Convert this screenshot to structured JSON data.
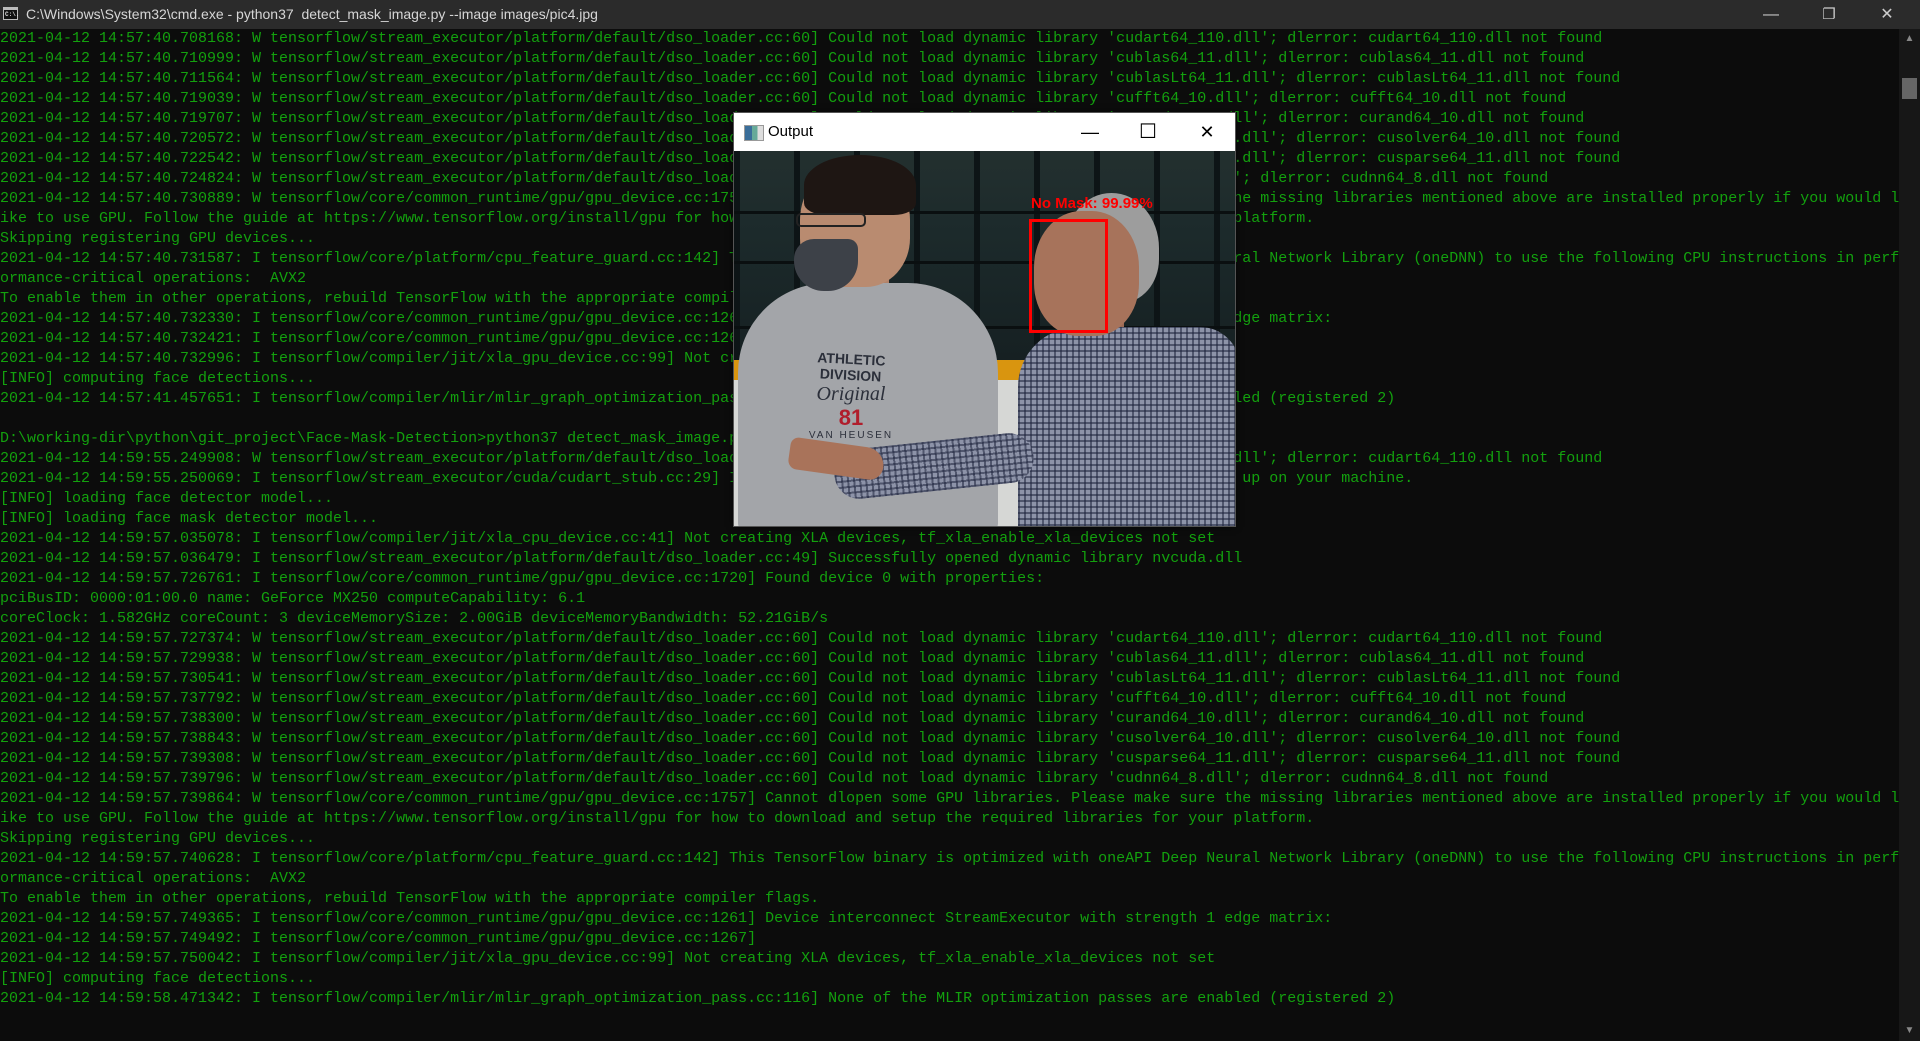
{
  "window": {
    "title": "C:\\Windows\\System32\\cmd.exe - python37  detect_mask_image.py --image images/pic4.jpg",
    "icon": "cmd-icon",
    "icon_text": "C:\\.",
    "minimize": "—",
    "restore": "❐",
    "close": "✕"
  },
  "colors": {
    "text": "#13a10e",
    "background": "#0c0c0c",
    "detection": "#ff0000"
  },
  "scrollbar": {
    "up": "▲",
    "down": "▼"
  },
  "terminal": {
    "lines": [
      "2021-04-12 14:57:40.708168: W tensorflow/stream_executor/platform/default/dso_loader.cc:60] Could not load dynamic library 'cudart64_110.dll'; dlerror: cudart64_110.dll not found",
      "2021-04-12 14:57:40.710999: W tensorflow/stream_executor/platform/default/dso_loader.cc:60] Could not load dynamic library 'cublas64_11.dll'; dlerror: cublas64_11.dll not found",
      "2021-04-12 14:57:40.711564: W tensorflow/stream_executor/platform/default/dso_loader.cc:60] Could not load dynamic library 'cublasLt64_11.dll'; dlerror: cublasLt64_11.dll not found",
      "2021-04-12 14:57:40.719039: W tensorflow/stream_executor/platform/default/dso_loader.cc:60] Could not load dynamic library 'cufft64_10.dll'; dlerror: cufft64_10.dll not found",
      "2021-04-12 14:57:40.719707: W tensorflow/stream_executor/platform/default/dso_loader.cc:60] Could not load dynamic library 'curand64_10.dll'; dlerror: curand64_10.dll not found",
      "2021-04-12 14:57:40.720572: W tensorflow/stream_executor/platform/default/dso_loader.cc:60] Could not load dynamic library 'cusolver64_10.dll'; dlerror: cusolver64_10.dll not found",
      "2021-04-12 14:57:40.722542: W tensorflow/stream_executor/platform/default/dso_loader.cc:60] Could not load dynamic library 'cusparse64_11.dll'; dlerror: cusparse64_11.dll not found",
      "2021-04-12 14:57:40.724824: W tensorflow/stream_executor/platform/default/dso_loader.cc:60] Could not load dynamic library 'cudnn64_8.dll'; dlerror: cudnn64_8.dll not found",
      "2021-04-12 14:57:40.730889: W tensorflow/core/common_runtime/gpu/gpu_device.cc:1757] Cannot dlopen some GPU libraries. Please make sure the missing libraries mentioned above are installed properly if you would l",
      "ike to use GPU. Follow the guide at https://www.tensorflow.org/install/gpu for how to download and setup the required libraries for your platform.",
      "Skipping registering GPU devices...",
      "2021-04-12 14:57:40.731587: I tensorflow/core/platform/cpu_feature_guard.cc:142] This TensorFlow binary is optimized with oneAPI Deep Neural Network Library (oneDNN) to use the following CPU instructions in perf",
      "ormance-critical operations:  AVX2",
      "To enable them in other operations, rebuild TensorFlow with the appropriate compiler flags.",
      "2021-04-12 14:57:40.732330: I tensorflow/core/common_runtime/gpu/gpu_device.cc:1261] Device interconnect StreamExecutor with strength 1 edge matrix:",
      "2021-04-12 14:57:40.732421: I tensorflow/core/common_runtime/gpu/gpu_device.cc:1267]",
      "2021-04-12 14:57:40.732996: I tensorflow/compiler/jit/xla_gpu_device.cc:99] Not creating XLA devices, tf_xla_enable_xla_devices not set",
      "[INFO] computing face detections...",
      "2021-04-12 14:57:41.457651: I tensorflow/compiler/mlir/mlir_graph_optimization_pass.cc:116] None of the MLIR optimization passes are enabled (registered 2)",
      "",
      "D:\\working-dir\\python\\git_project\\Face-Mask-Detection>python37 detect_mask_image.py --image images/pic4.jpg",
      "2021-04-12 14:59:55.249908: W tensorflow/stream_executor/platform/default/dso_loader.cc:60] Could not load dynamic library 'cudart64_110.dll'; dlerror: cudart64_110.dll not found",
      "2021-04-12 14:59:55.250069: I tensorflow/stream_executor/cuda/cudart_stub.cc:29] Ignore above cudart dlerror if you do not have a GPU set up on your machine.",
      "[INFO] loading face detector model...",
      "[INFO] loading face mask detector model...",
      "2021-04-12 14:59:57.035078: I tensorflow/compiler/jit/xla_cpu_device.cc:41] Not creating XLA devices, tf_xla_enable_xla_devices not set",
      "2021-04-12 14:59:57.036479: I tensorflow/stream_executor/platform/default/dso_loader.cc:49] Successfully opened dynamic library nvcuda.dll",
      "2021-04-12 14:59:57.726761: I tensorflow/core/common_runtime/gpu/gpu_device.cc:1720] Found device 0 with properties:",
      "pciBusID: 0000:01:00.0 name: GeForce MX250 computeCapability: 6.1",
      "coreClock: 1.582GHz coreCount: 3 deviceMemorySize: 2.00GiB deviceMemoryBandwidth: 52.21GiB/s",
      "2021-04-12 14:59:57.727374: W tensorflow/stream_executor/platform/default/dso_loader.cc:60] Could not load dynamic library 'cudart64_110.dll'; dlerror: cudart64_110.dll not found",
      "2021-04-12 14:59:57.729938: W tensorflow/stream_executor/platform/default/dso_loader.cc:60] Could not load dynamic library 'cublas64_11.dll'; dlerror: cublas64_11.dll not found",
      "2021-04-12 14:59:57.730541: W tensorflow/stream_executor/platform/default/dso_loader.cc:60] Could not load dynamic library 'cublasLt64_11.dll'; dlerror: cublasLt64_11.dll not found",
      "2021-04-12 14:59:57.737792: W tensorflow/stream_executor/platform/default/dso_loader.cc:60] Could not load dynamic library 'cufft64_10.dll'; dlerror: cufft64_10.dll not found",
      "2021-04-12 14:59:57.738300: W tensorflow/stream_executor/platform/default/dso_loader.cc:60] Could not load dynamic library 'curand64_10.dll'; dlerror: curand64_10.dll not found",
      "2021-04-12 14:59:57.738843: W tensorflow/stream_executor/platform/default/dso_loader.cc:60] Could not load dynamic library 'cusolver64_10.dll'; dlerror: cusolver64_10.dll not found",
      "2021-04-12 14:59:57.739308: W tensorflow/stream_executor/platform/default/dso_loader.cc:60] Could not load dynamic library 'cusparse64_11.dll'; dlerror: cusparse64_11.dll not found",
      "2021-04-12 14:59:57.739796: W tensorflow/stream_executor/platform/default/dso_loader.cc:60] Could not load dynamic library 'cudnn64_8.dll'; dlerror: cudnn64_8.dll not found",
      "2021-04-12 14:59:57.739864: W tensorflow/core/common_runtime/gpu/gpu_device.cc:1757] Cannot dlopen some GPU libraries. Please make sure the missing libraries mentioned above are installed properly if you would l",
      "ike to use GPU. Follow the guide at https://www.tensorflow.org/install/gpu for how to download and setup the required libraries for your platform.",
      "Skipping registering GPU devices...",
      "2021-04-12 14:59:57.740628: I tensorflow/core/platform/cpu_feature_guard.cc:142] This TensorFlow binary is optimized with oneAPI Deep Neural Network Library (oneDNN) to use the following CPU instructions in perf",
      "ormance-critical operations:  AVX2",
      "To enable them in other operations, rebuild TensorFlow with the appropriate compiler flags.",
      "2021-04-12 14:59:57.749365: I tensorflow/core/common_runtime/gpu/gpu_device.cc:1261] Device interconnect StreamExecutor with strength 1 edge matrix:",
      "2021-04-12 14:59:57.749492: I tensorflow/core/common_runtime/gpu/gpu_device.cc:1267]",
      "2021-04-12 14:59:57.750042: I tensorflow/compiler/jit/xla_gpu_device.cc:99] Not creating XLA devices, tf_xla_enable_xla_devices not set",
      "[INFO] computing face detections...",
      "2021-04-12 14:59:58.471342: I tensorflow/compiler/mlir/mlir_graph_optimization_pass.cc:116] None of the MLIR optimization passes are enabled (registered 2)"
    ]
  },
  "output_window": {
    "title": "Output",
    "minimize": "—",
    "maximize": "☐",
    "close": "✕",
    "detection_label": "No Mask: 99.99%",
    "shirt_text": {
      "line1": "ATHLETIC DIVISION",
      "line2": "Original",
      "line3": "81",
      "line4": "VAN HEUSEN"
    }
  }
}
